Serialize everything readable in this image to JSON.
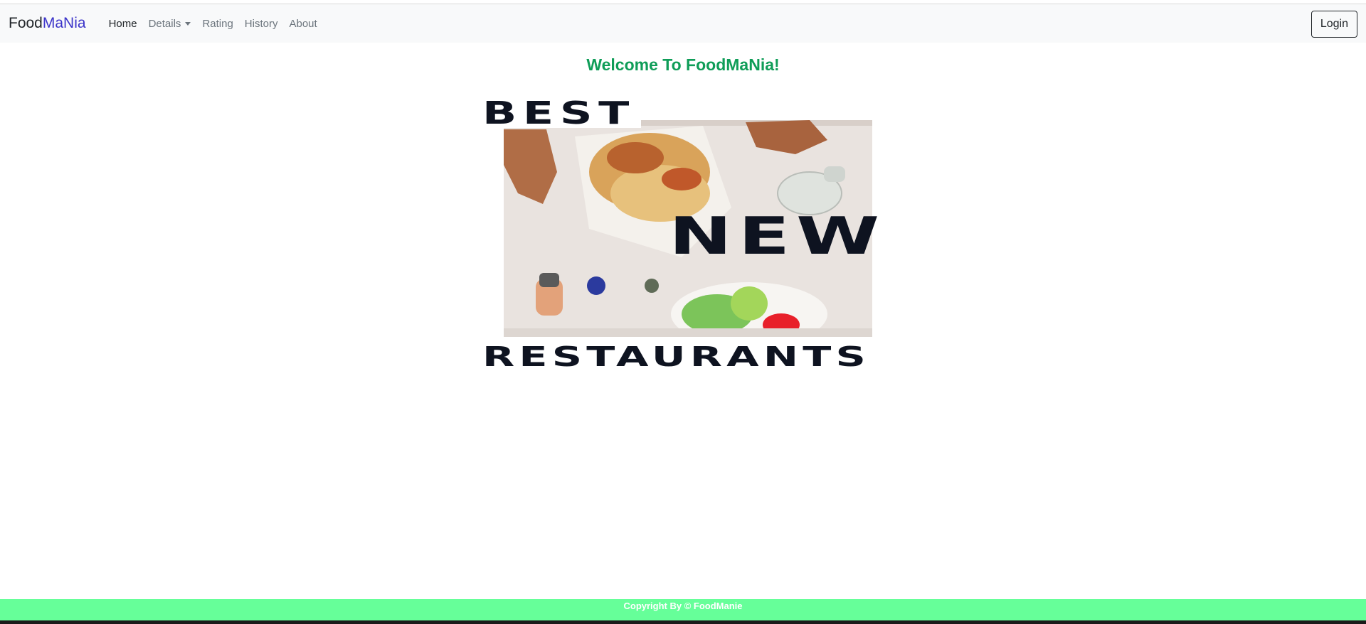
{
  "navbar": {
    "brand_part1": "Food",
    "brand_part2": "MaNia",
    "links": [
      {
        "label": "Home",
        "active": true
      },
      {
        "label": "Details",
        "dropdown": true
      },
      {
        "label": "Rating"
      },
      {
        "label": "History"
      },
      {
        "label": "About"
      }
    ],
    "login_label": "Login"
  },
  "main": {
    "welcome_title": "Welcome To FoodMaNia!",
    "hero": {
      "line1": "BEST",
      "line2": "NEW",
      "line3": "RESTAURANTS"
    }
  },
  "footer": {
    "copyright": "Copyright By © FoodManie"
  },
  "colors": {
    "brand_accent": "#3b34c9",
    "welcome_green": "#0f9d58",
    "footer_bg": "#66ff99",
    "navbar_bg": "#f8f9fa"
  }
}
